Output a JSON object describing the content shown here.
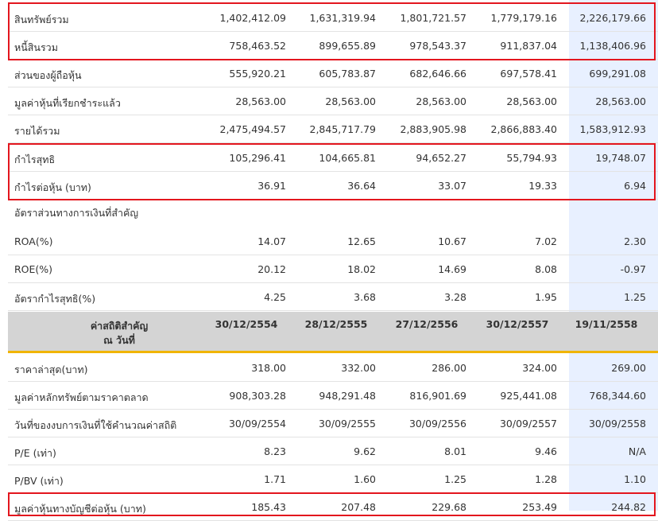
{
  "colors": {
    "highlight_column": "#e8f0ff",
    "header_band": "#d4d4d4",
    "accent_line": "#f0b400",
    "annotation_box": "#e3161e"
  },
  "rows_top": [
    {
      "label": "สินทรัพย์รวม",
      "values": [
        "1,402,412.09",
        "1,631,319.94",
        "1,801,721.57",
        "1,779,179.16",
        "2,226,179.66"
      ]
    },
    {
      "label": "หนี้สินรวม",
      "values": [
        "758,463.52",
        "899,655.89",
        "978,543.37",
        "911,837.04",
        "1,138,406.96"
      ]
    },
    {
      "label": "ส่วนของผู้ถือหุ้น",
      "values": [
        "555,920.21",
        "605,783.87",
        "682,646.66",
        "697,578.41",
        "699,291.08"
      ]
    },
    {
      "label": "มูลค่าหุ้นที่เรียกชำระแล้ว",
      "values": [
        "28,563.00",
        "28,563.00",
        "28,563.00",
        "28,563.00",
        "28,563.00"
      ]
    },
    {
      "label": "รายได้รวม",
      "values": [
        "2,475,494.57",
        "2,845,717.79",
        "2,883,905.98",
        "2,866,883.40",
        "1,583,912.93"
      ]
    },
    {
      "label": "กำไรสุทธิ",
      "values": [
        "105,296.41",
        "104,665.81",
        "94,652.27",
        "55,794.93",
        "19,748.07"
      ]
    },
    {
      "label": "กำไรต่อหุ้น (บาท)",
      "values": [
        "36.91",
        "36.64",
        "33.07",
        "19.33",
        "6.94"
      ]
    }
  ],
  "ratios_section": {
    "title": "อัตราส่วนทางการเงินที่สำคัญ",
    "rows": [
      {
        "label": "ROA(%)",
        "values": [
          "14.07",
          "12.65",
          "10.67",
          "7.02",
          "2.30"
        ]
      },
      {
        "label": "ROE(%)",
        "values": [
          "20.12",
          "18.02",
          "14.69",
          "8.08",
          "-0.97"
        ]
      },
      {
        "label": "อัตรากำไรสุทธิ(%)",
        "values": [
          "4.25",
          "3.68",
          "3.28",
          "1.95",
          "1.25"
        ]
      }
    ]
  },
  "stats_header": {
    "label_line1": "ค่าสถิติสำคัญ",
    "label_line2": "ณ วันที่",
    "dates": [
      "30/12/2554",
      "28/12/2555",
      "27/12/2556",
      "30/12/2557",
      "19/11/2558"
    ]
  },
  "stats_rows": [
    {
      "label": "ราคาล่าสุด(บาท)",
      "values": [
        "318.00",
        "332.00",
        "286.00",
        "324.00",
        "269.00"
      ]
    },
    {
      "label": "มูลค่าหลักทรัพย์ตามราคาตลาด",
      "values": [
        "908,303.28",
        "948,291.48",
        "816,901.69",
        "925,441.08",
        "768,344.60"
      ]
    },
    {
      "label": "วันที่ของงบการเงินที่ใช้คำนวณค่าสถิติ",
      "values": [
        "30/09/2554",
        "30/09/2555",
        "30/09/2556",
        "30/09/2557",
        "30/09/2558"
      ]
    },
    {
      "label": "P/E (เท่า)",
      "values": [
        "8.23",
        "9.62",
        "8.01",
        "9.46",
        "N/A"
      ]
    },
    {
      "label": "P/BV (เท่า)",
      "values": [
        "1.71",
        "1.60",
        "1.25",
        "1.28",
        "1.10"
      ]
    },
    {
      "label": "มูลค่าหุ้นทางบัญชีต่อหุ้น (บาท)",
      "values": [
        "185.43",
        "207.48",
        "229.68",
        "253.49",
        "244.82"
      ]
    }
  ]
}
